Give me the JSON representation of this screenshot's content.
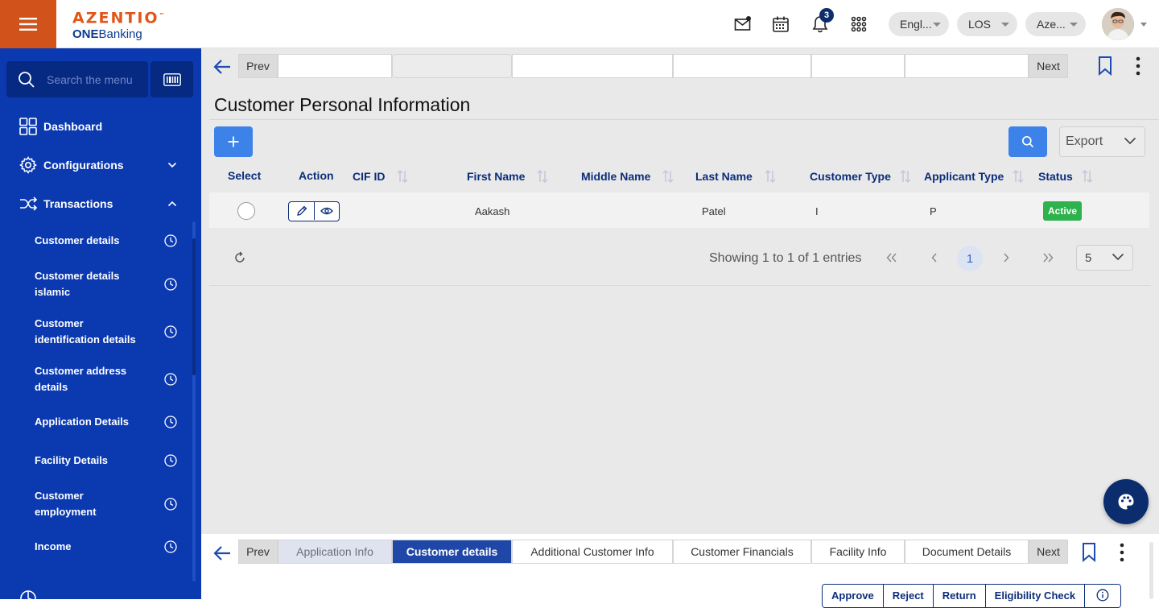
{
  "header": {
    "logo_brand": "AZENTIO",
    "logo_tm": "™",
    "logo_sub_bold": "ONE",
    "logo_sub_rest": "Banking",
    "notification_count": "3",
    "language": "Engl...",
    "module": "LOS",
    "entity": "Aze..."
  },
  "sidebar": {
    "search_placeholder": "Search the menu",
    "top_items": [
      {
        "label": "Dashboard",
        "icon": "dashboard-grid-icon"
      },
      {
        "label": "Configurations",
        "icon": "gear-icon"
      },
      {
        "label": "Transactions",
        "icon": "shuffle-icon"
      }
    ],
    "sub_items": [
      {
        "label": "Customer details"
      },
      {
        "label": "Customer details islamic"
      },
      {
        "label": "Customer identification details"
      },
      {
        "label": "Customer address details"
      },
      {
        "label": "Application Details"
      },
      {
        "label": "Facility Details"
      },
      {
        "label": "Customer employment"
      },
      {
        "label": "Income"
      }
    ]
  },
  "top_tabbar": {
    "prev_label": "Prev",
    "next_label": "Next",
    "tabs": [
      "",
      "",
      "",
      "",
      "",
      ""
    ]
  },
  "page": {
    "title": "Customer Personal Information"
  },
  "toolbar": {
    "export_label": "Export"
  },
  "table": {
    "columns": [
      "Select",
      "Action",
      "CIF ID",
      "First Name",
      "Middle Name",
      "Last Name",
      "Customer Type",
      "Applicant Type",
      "Status"
    ],
    "rows": [
      {
        "cif_id": "",
        "first_name": "Aakash",
        "middle_name": "",
        "last_name": "Patel",
        "customer_type": "I",
        "applicant_type": "P",
        "status": "Active"
      }
    ]
  },
  "pagination": {
    "summary": "Showing 1 to 1 of 1 entries",
    "current_page": "1",
    "page_size": "5"
  },
  "bottom_tabbar": {
    "prev_label": "Prev",
    "next_label": "Next",
    "tabs": [
      {
        "label": "Application Info",
        "state": "visited"
      },
      {
        "label": "Customer details",
        "state": "active"
      },
      {
        "label": "Additional Customer Info",
        "state": "normal"
      },
      {
        "label": "Customer Financials",
        "state": "normal"
      },
      {
        "label": "Facility Info",
        "state": "normal"
      },
      {
        "label": "Document Details",
        "state": "normal"
      }
    ]
  },
  "actions": {
    "approve": "Approve",
    "reject": "Reject",
    "return": "Return",
    "eligibility": "Eligibility Check"
  },
  "colors": {
    "brand_orange": "#d1531b",
    "sidebar_blue": "#0a39b0",
    "navy": "#0b2d7a",
    "primary_button": "#3c82e8",
    "status_active": "#2db24d"
  }
}
